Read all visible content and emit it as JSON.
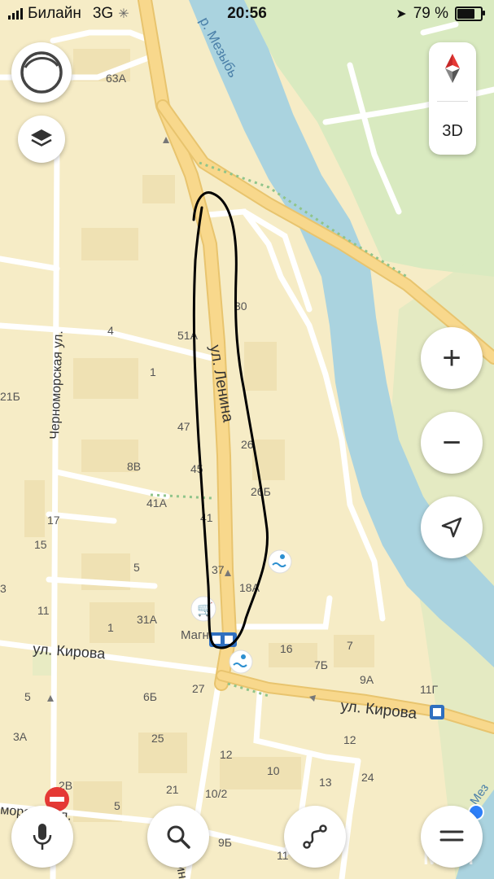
{
  "status_bar": {
    "carrier": "Билайн",
    "network": "3G",
    "time": "20:56",
    "battery": "79 %",
    "battery_level": 0.79
  },
  "controls": {
    "layers_button": "layers-icon",
    "compass_button": "compass-icon",
    "view_3d_label": "3D",
    "zoom_in": "+",
    "zoom_out": "−",
    "locate_button": "location-arrow-icon",
    "mic_button": "microphone-icon",
    "search_button": "search-icon",
    "route_button": "route-icon",
    "menu_button": "menu-icon"
  },
  "map": {
    "colors": {
      "land": "#f6ecc6",
      "water": "#aad3df",
      "park": "#d9eac0",
      "main_road": "#f8d88c",
      "road": "#ffffff",
      "block": "#efe1b3",
      "ink": "#000000"
    },
    "streets": {
      "lenina": "ул. Ленина",
      "kirova_west": "ул. Кирова",
      "kirova_east": "ул. Кирова",
      "chernomorskaya": "Черноморская ул.",
      "chernomorskaya_bottom": "морская ул.",
      "lenina_bottom": "Ленина"
    },
    "river": "р. Мезыбь",
    "river_bottom": "Мез",
    "poi": {
      "shop": "Магнит"
    },
    "house_numbers": [
      "63А",
      "30",
      "4",
      "51А",
      "1",
      "21Б",
      "47",
      "26",
      "8В",
      "45",
      "26Б",
      "41А",
      "41",
      "17",
      "15",
      "5",
      "37",
      "18А",
      "3",
      "11",
      "31А",
      "1",
      "16",
      "7",
      "7Б",
      "9А",
      "11Г",
      "27",
      "6Б",
      "5",
      "3А",
      "25",
      "12",
      "12",
      "10",
      "13",
      "24",
      "21",
      "10/2",
      "2В",
      "5",
      "9Б",
      "11"
    ]
  },
  "watermark": "МАМ"
}
